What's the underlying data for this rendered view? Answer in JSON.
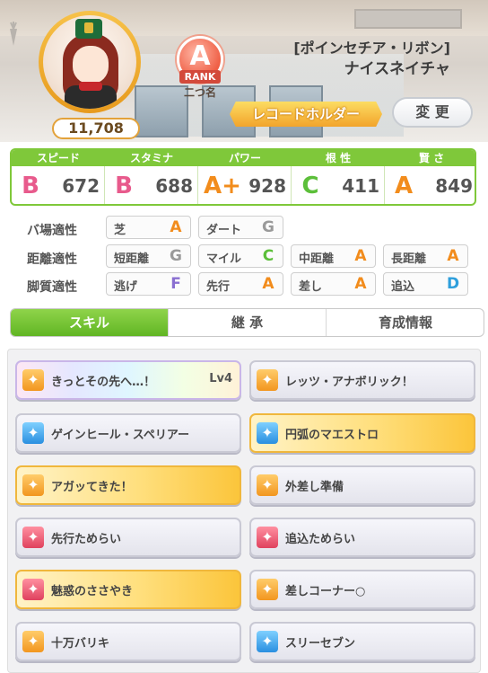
{
  "header": {
    "fans": "11,708",
    "rank_letter": "A",
    "rank_label": "RANK",
    "rank_sub": "二つ名",
    "character_title": "[ポインセチア・リボン]",
    "character_name": "ナイスネイチャ",
    "epithet": "レコードホルダー",
    "change_button": "変 更"
  },
  "stats": [
    {
      "label": "スピード",
      "grade": "B",
      "value": "672",
      "grade_color": "#e85a8c",
      "icon": "shoe-icon"
    },
    {
      "label": "スタミナ",
      "grade": "B",
      "value": "688",
      "grade_color": "#e85a8c",
      "icon": "heart-icon"
    },
    {
      "label": "パワー",
      "grade": "A+",
      "value": "928",
      "grade_color": "#f28c1c",
      "icon": "arm-icon"
    },
    {
      "label": "根 性",
      "grade": "C",
      "value": "411",
      "grade_color": "#5cbf3a",
      "icon": "flame-icon"
    },
    {
      "label": "賢 さ",
      "grade": "A",
      "value": "849",
      "grade_color": "#f28c1c",
      "icon": "graduation-cap-icon"
    }
  ],
  "aptitudes": {
    "track": {
      "label": "バ場適性",
      "items": [
        {
          "name": "芝",
          "grade": "A"
        },
        {
          "name": "ダート",
          "grade": "G"
        }
      ]
    },
    "distance": {
      "label": "距離適性",
      "items": [
        {
          "name": "短距離",
          "grade": "G"
        },
        {
          "name": "マイル",
          "grade": "C"
        },
        {
          "name": "中距離",
          "grade": "A"
        },
        {
          "name": "長距離",
          "grade": "A"
        }
      ]
    },
    "strategy": {
      "label": "脚質適性",
      "items": [
        {
          "name": "逃げ",
          "grade": "F"
        },
        {
          "name": "先行",
          "grade": "A"
        },
        {
          "name": "差し",
          "grade": "A"
        },
        {
          "name": "追込",
          "grade": "D"
        }
      ]
    }
  },
  "grade_colors": {
    "A": "#f28c1c",
    "B": "#e85a8c",
    "C": "#5cbf3a",
    "D": "#2e9fdc",
    "F": "#8a6fd1",
    "G": "#9a9a9a"
  },
  "tabs": [
    "スキル",
    "継 承",
    "育成情報"
  ],
  "active_tab": "スキル",
  "skills": [
    {
      "name": "きっとその先へ…！",
      "level": "Lv4",
      "style": "rainbow",
      "icon": "orange"
    },
    {
      "name": "レッツ・アナボリック！",
      "level": "",
      "style": "normal",
      "icon": "orange"
    },
    {
      "name": "ゲインヒール・スペリアー",
      "level": "",
      "style": "normal",
      "icon": "blue"
    },
    {
      "name": "円弧のマエストロ",
      "level": "",
      "style": "gold",
      "icon": "blue"
    },
    {
      "name": "アガッてきた！",
      "level": "",
      "style": "gold",
      "icon": "orange"
    },
    {
      "name": "外差し準備",
      "level": "",
      "style": "normal",
      "icon": "orange"
    },
    {
      "name": "先行ためらい",
      "level": "",
      "style": "normal",
      "icon": "red"
    },
    {
      "name": "追込ためらい",
      "level": "",
      "style": "normal",
      "icon": "red"
    },
    {
      "name": "魅惑のささやき",
      "level": "",
      "style": "gold",
      "icon": "red"
    },
    {
      "name": "差しコーナー○",
      "level": "",
      "style": "normal",
      "icon": "orange"
    },
    {
      "name": "十万バリキ",
      "level": "",
      "style": "normal",
      "icon": "orange"
    },
    {
      "name": "スリーセブン",
      "level": "",
      "style": "normal",
      "icon": "blue"
    }
  ]
}
